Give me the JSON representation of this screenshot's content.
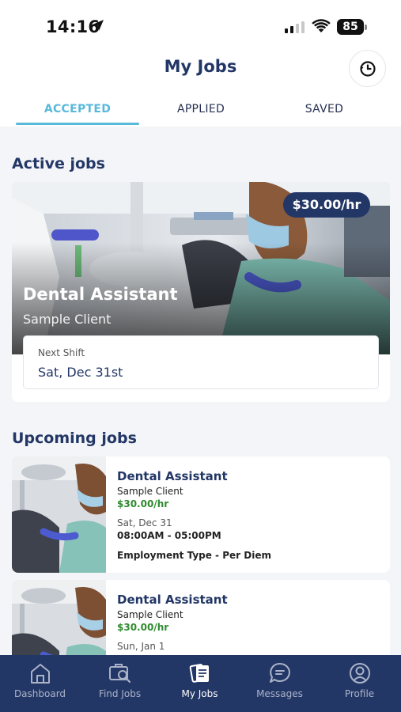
{
  "status_bar": {
    "time": "14:16",
    "battery": "85"
  },
  "header": {
    "title": "My Jobs"
  },
  "tabs": [
    {
      "label": "ACCEPTED",
      "active": true
    },
    {
      "label": "APPLIED",
      "active": false
    },
    {
      "label": "SAVED",
      "active": false
    }
  ],
  "active_section": {
    "title": "Active jobs",
    "job": {
      "rate": "$30.00/hr",
      "title": "Dental Assistant",
      "client": "Sample Client",
      "next_shift_label": "Next Shift",
      "next_shift_date": "Sat, Dec 31st"
    }
  },
  "upcoming_section": {
    "title": "Upcoming jobs",
    "jobs": [
      {
        "title": "Dental Assistant",
        "client": "Sample Client",
        "rate": "$30.00/hr",
        "date": "Sat, Dec 31",
        "time": "08:00AM - 05:00PM",
        "employment_type": "Employment Type - Per Diem"
      },
      {
        "title": "Dental Assistant",
        "client": "Sample Client",
        "rate": "$30.00/hr",
        "date": "Sun, Jan 1",
        "time": "",
        "employment_type": ""
      }
    ]
  },
  "bottom_nav": [
    {
      "label": "Dashboard",
      "icon": "home-icon",
      "active": false
    },
    {
      "label": "Find Jobs",
      "icon": "find-jobs-icon",
      "active": false
    },
    {
      "label": "My Jobs",
      "icon": "my-jobs-icon",
      "active": true
    },
    {
      "label": "Messages",
      "icon": "messages-icon",
      "active": false
    },
    {
      "label": "Profile",
      "icon": "profile-icon",
      "active": false
    }
  ],
  "colors": {
    "brand_navy": "#233766",
    "accent_blue": "#59b9da",
    "rate_green": "#2e8b2e",
    "background": "#f4f5f8"
  }
}
